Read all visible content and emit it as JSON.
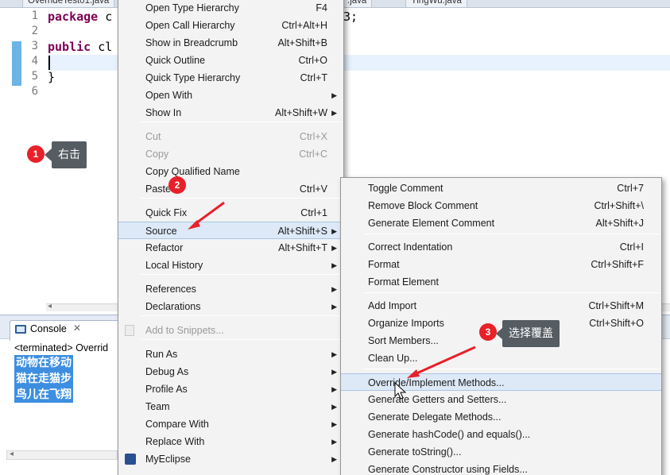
{
  "editor": {
    "tabs": [
      "OverrideTest01.java",
      ".java",
      "YingWu.java"
    ],
    "lines": [
      {
        "num": "1",
        "code_kw": "package",
        "code_rest": " c",
        "code_tail": "3;"
      },
      {
        "num": "2",
        "code_kw": "",
        "code_rest": "",
        "code_tail": ""
      },
      {
        "num": "3",
        "code_kw": "public",
        "code_rest": " cl",
        "code_tail": ""
      },
      {
        "num": "4",
        "code_kw": "",
        "code_rest": "",
        "code_tail": ""
      },
      {
        "num": "5",
        "code_kw": "",
        "code_rest": "}",
        "code_tail": ""
      },
      {
        "num": "6",
        "code_kw": "",
        "code_rest": "",
        "code_tail": ""
      }
    ]
  },
  "console": {
    "tab_label": "Console",
    "close_glyph": "✕",
    "status": "<terminated> Overrid",
    "output": [
      "动物在移动",
      "猫在走猫步",
      "鸟儿在飞翔"
    ]
  },
  "context_menu": {
    "items": [
      {
        "label": "Open Type Hierarchy",
        "shortcut": "F4",
        "submenu": false,
        "disabled": false
      },
      {
        "label": "Open Call Hierarchy",
        "shortcut": "Ctrl+Alt+H",
        "submenu": false,
        "disabled": false
      },
      {
        "label": "Show in Breadcrumb",
        "shortcut": "Alt+Shift+B",
        "submenu": false,
        "disabled": false
      },
      {
        "label": "Quick Outline",
        "shortcut": "Ctrl+O",
        "submenu": false,
        "disabled": false
      },
      {
        "label": "Quick Type Hierarchy",
        "shortcut": "Ctrl+T",
        "submenu": false,
        "disabled": false
      },
      {
        "label": "Open With",
        "shortcut": "",
        "submenu": true,
        "disabled": false
      },
      {
        "label": "Show In",
        "shortcut": "Alt+Shift+W",
        "submenu": true,
        "disabled": false
      },
      {
        "label": "Cut",
        "shortcut": "Ctrl+X",
        "submenu": false,
        "disabled": true
      },
      {
        "label": "Copy",
        "shortcut": "Ctrl+C",
        "submenu": false,
        "disabled": true
      },
      {
        "label": "Copy Qualified Name",
        "shortcut": "",
        "submenu": false,
        "disabled": false
      },
      {
        "label": "Paste",
        "shortcut": "Ctrl+V",
        "submenu": false,
        "disabled": false
      },
      {
        "label": "Quick Fix",
        "shortcut": "Ctrl+1",
        "submenu": false,
        "disabled": false
      },
      {
        "label": "Source",
        "shortcut": "Alt+Shift+S",
        "submenu": true,
        "disabled": false,
        "highlighted": true
      },
      {
        "label": "Refactor",
        "shortcut": "Alt+Shift+T",
        "submenu": true,
        "disabled": false
      },
      {
        "label": "Local History",
        "shortcut": "",
        "submenu": true,
        "disabled": false
      },
      {
        "label": "References",
        "shortcut": "",
        "submenu": true,
        "disabled": false
      },
      {
        "label": "Declarations",
        "shortcut": "",
        "submenu": true,
        "disabled": false
      },
      {
        "label": "Add to Snippets...",
        "shortcut": "",
        "submenu": false,
        "disabled": true
      },
      {
        "label": "Run As",
        "shortcut": "",
        "submenu": true,
        "disabled": false
      },
      {
        "label": "Debug As",
        "shortcut": "",
        "submenu": true,
        "disabled": false
      },
      {
        "label": "Profile As",
        "shortcut": "",
        "submenu": true,
        "disabled": false
      },
      {
        "label": "Team",
        "shortcut": "",
        "submenu": true,
        "disabled": false
      },
      {
        "label": "Compare With",
        "shortcut": "",
        "submenu": true,
        "disabled": false
      },
      {
        "label": "Replace With",
        "shortcut": "",
        "submenu": true,
        "disabled": false
      },
      {
        "label": "MyEclipse",
        "shortcut": "",
        "submenu": true,
        "disabled": false
      }
    ]
  },
  "source_menu": {
    "items": [
      {
        "label": "Toggle Comment",
        "shortcut": "Ctrl+7"
      },
      {
        "label": "Remove Block Comment",
        "shortcut": "Ctrl+Shift+\\"
      },
      {
        "label": "Generate Element Comment",
        "shortcut": "Alt+Shift+J"
      },
      {
        "label": "Correct Indentation",
        "shortcut": "Ctrl+I"
      },
      {
        "label": "Format",
        "shortcut": "Ctrl+Shift+F"
      },
      {
        "label": "Format Element",
        "shortcut": ""
      },
      {
        "label": "Add Import",
        "shortcut": "Ctrl+Shift+M"
      },
      {
        "label": "Organize Imports",
        "shortcut": "Ctrl+Shift+O"
      },
      {
        "label": "Sort Members...",
        "shortcut": ""
      },
      {
        "label": "Clean Up...",
        "shortcut": ""
      },
      {
        "label": "Override/Implement Methods...",
        "shortcut": "",
        "highlighted": true
      },
      {
        "label": "Generate Getters and Setters...",
        "shortcut": ""
      },
      {
        "label": "Generate Delegate Methods...",
        "shortcut": ""
      },
      {
        "label": "Generate hashCode() and equals()...",
        "shortcut": ""
      },
      {
        "label": "Generate toString()...",
        "shortcut": ""
      },
      {
        "label": "Generate Constructor using Fields...",
        "shortcut": ""
      }
    ]
  },
  "annotations": {
    "step1": {
      "num": "1",
      "text": "右击"
    },
    "step2": {
      "num": "2"
    },
    "step3": {
      "num": "3",
      "text": "选择覆盖"
    }
  },
  "colors": {
    "accent": "#e8202a",
    "highlight": "#dde9f7",
    "console_selection": "#3d8ee0",
    "tooltip": "#555c62"
  }
}
